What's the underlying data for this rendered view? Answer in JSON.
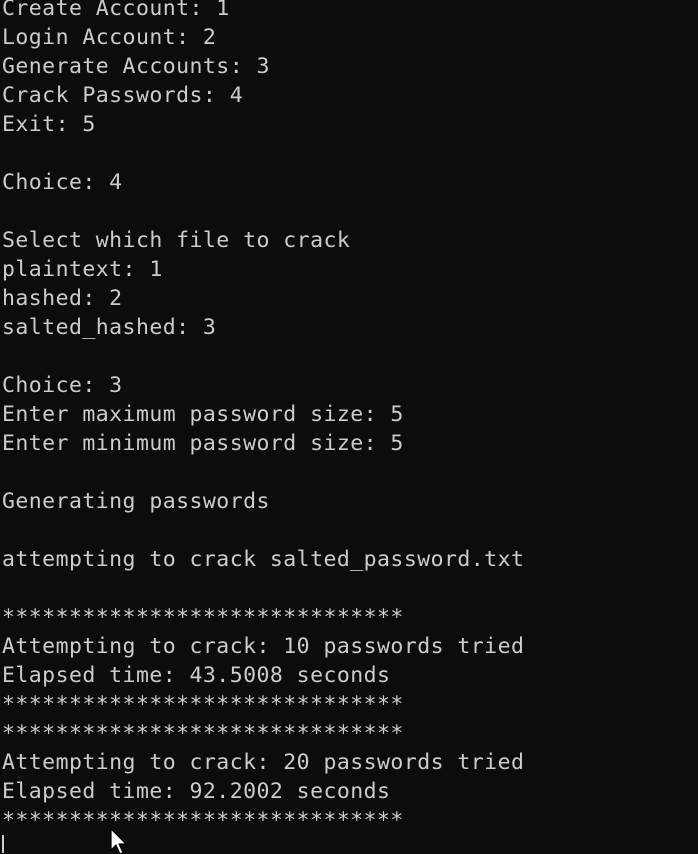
{
  "terminal": {
    "lines": [
      "Create Account: 1",
      "Login Account: 2",
      "Generate Accounts: 3",
      "Crack Passwords: 4",
      "Exit: 5",
      "",
      "Choice: 4",
      "",
      "Select which file to crack",
      "plaintext: 1",
      "hashed: 2",
      "salted_hashed: 3",
      "",
      "Choice: 3",
      "Enter maximum password size: 5",
      "Enter minimum password size: 5",
      "",
      "Generating passwords",
      "",
      "attempting to crack salted_password.txt",
      "",
      "******************************",
      "Attempting to crack: 10 passwords tried",
      "Elapsed time: 43.5008 seconds",
      "******************************",
      "******************************",
      "Attempting to crack: 20 passwords tried",
      "Elapsed time: 92.2002 seconds",
      "******************************"
    ],
    "colors": {
      "background": "#0c0c0c",
      "foreground": "#cccccc"
    },
    "pointer_icon": "mouse-pointer-icon"
  }
}
